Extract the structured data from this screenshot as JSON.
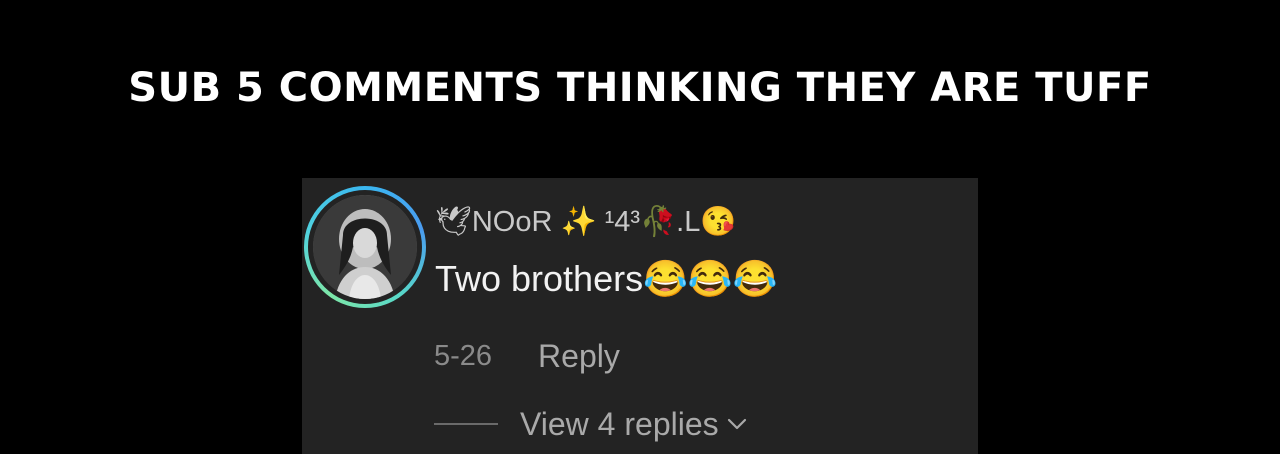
{
  "headline": "SUB 5 COMMENTS THINKING THEY ARE TUFF",
  "comment": {
    "username": "🕊NOoR ✨ ¹4³🥀.L😘",
    "text": "Two brothers😂😂😂",
    "date": "5-26",
    "reply_label": "Reply",
    "view_replies_label": "View 4 replies"
  },
  "colors": {
    "background": "#000000",
    "card": "#232323",
    "avatar_ring": "#3ab7f0",
    "secondary_text": "#a9a9a9"
  },
  "icons": {
    "reply_expand": "chevron-down-icon"
  }
}
